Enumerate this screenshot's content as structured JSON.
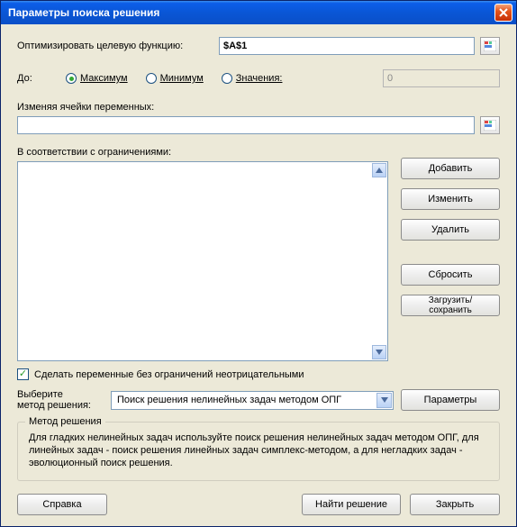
{
  "window": {
    "title": "Параметры поиска решения"
  },
  "objective": {
    "label": "Оптимизировать целевую функцию:",
    "value": "$A$1"
  },
  "to": {
    "label": "До:",
    "options": {
      "max": "Максимум",
      "min": "Минимум",
      "value": "Значения:"
    },
    "selected": "max",
    "value_input": "0"
  },
  "variables": {
    "label": "Изменяя ячейки переменных:",
    "value": ""
  },
  "constraints": {
    "label": "В соответствии с ограничениями:"
  },
  "side_buttons": {
    "add": "Добавить",
    "change": "Изменить",
    "delete": "Удалить",
    "reset": "Сбросить",
    "load_save": "Загрузить/сохранить"
  },
  "nonneg": {
    "checked": true,
    "label": "Сделать переменные без ограничений неотрицательными"
  },
  "method": {
    "label1": "Выберите",
    "label2": "метод решения:",
    "selected": "Поиск решения нелинейных задач методом ОПГ",
    "params_btn": "Параметры"
  },
  "method_group": {
    "title": "Метод решения",
    "text": "Для гладких нелинейных задач используйте поиск решения нелинейных задач методом ОПГ, для линейных задач - поиск решения линейных задач симплекс-методом, а для негладких задач - эволюционный поиск решения."
  },
  "bottom": {
    "help": "Справка",
    "solve": "Найти решение",
    "close": "Закрыть"
  }
}
